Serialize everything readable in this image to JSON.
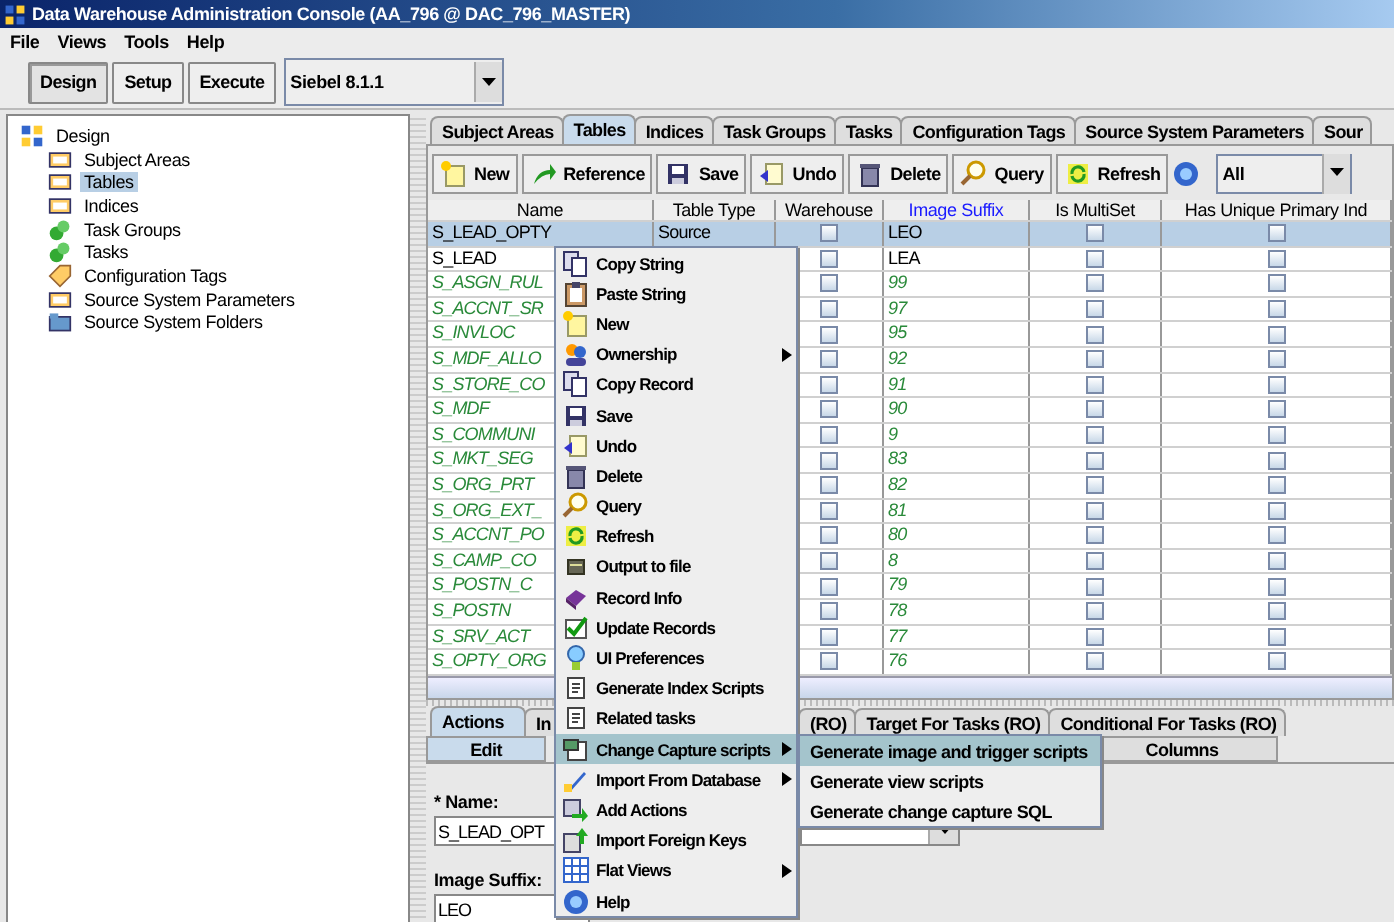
{
  "window": {
    "title": "Data Warehouse Administration Console (AA_796 @ DAC_796_MASTER)"
  },
  "menu_bar": [
    "File",
    "Views",
    "Tools",
    "Help"
  ],
  "toolbar": {
    "buttons": [
      {
        "label": "Design",
        "selected": true
      },
      {
        "label": "Setup",
        "selected": false
      },
      {
        "label": "Execute",
        "selected": false
      }
    ],
    "container": {
      "value": "Siebel 8.1.1"
    }
  },
  "tree": {
    "label": "Design",
    "children": [
      {
        "label": "Subject Areas",
        "selected": false
      },
      {
        "label": "Tables",
        "selected": true
      },
      {
        "label": "Indices",
        "selected": false
      },
      {
        "label": "Task Groups",
        "selected": false
      },
      {
        "label": "Tasks",
        "selected": false
      },
      {
        "label": "Configuration Tags",
        "selected": false
      },
      {
        "label": "Source System Parameters",
        "selected": false
      },
      {
        "label": "Source System Folders",
        "selected": false
      }
    ]
  },
  "tabs": [
    {
      "label": "Subject Areas",
      "selected": false
    },
    {
      "label": "Tables",
      "selected": true
    },
    {
      "label": "Indices",
      "selected": false
    },
    {
      "label": "Task Groups",
      "selected": false
    },
    {
      "label": "Tasks",
      "selected": false
    },
    {
      "label": "Configuration Tags",
      "selected": false
    },
    {
      "label": "Source System Parameters",
      "selected": false
    },
    {
      "label": "Sour",
      "selected": false
    }
  ],
  "table_toolbar": {
    "buttons": [
      "New",
      "Reference",
      "Save",
      "Undo",
      "Delete",
      "Query",
      "Refresh"
    ],
    "filter": {
      "value": "All"
    }
  },
  "table": {
    "columns": [
      {
        "label": "Name",
        "highlighted": false
      },
      {
        "label": "Table Type",
        "highlighted": false
      },
      {
        "label": "Warehouse",
        "highlighted": false
      },
      {
        "label": "Image Suffix",
        "highlighted": true
      },
      {
        "label": "Is MultiSet",
        "highlighted": false
      },
      {
        "label": "Has Unique Primary Ind",
        "highlighted": false
      }
    ],
    "rows": [
      {
        "name": "S_LEAD_OPTY",
        "table_type": "Source",
        "warehouse": false,
        "image_suffix": "LEO",
        "is_multiset": false,
        "has_unique_primary_index": false,
        "kind": "own",
        "selected": true
      },
      {
        "name": "S_LEAD",
        "warehouse": false,
        "image_suffix": "LEA",
        "is_multiset": false,
        "has_unique_primary_index": false,
        "kind": "own",
        "selected": false
      },
      {
        "name": "S_ASGN_RUL",
        "warehouse": false,
        "image_suffix": "99",
        "is_multiset": false,
        "has_unique_primary_index": false,
        "kind": "inherited",
        "selected": false
      },
      {
        "name": "S_ACCNT_SR",
        "warehouse": false,
        "image_suffix": "97",
        "is_multiset": false,
        "has_unique_primary_index": false,
        "kind": "inherited",
        "selected": false
      },
      {
        "name": "S_INVLOC",
        "warehouse": false,
        "image_suffix": "95",
        "is_multiset": false,
        "has_unique_primary_index": false,
        "kind": "inherited",
        "selected": false
      },
      {
        "name": "S_MDF_ALLO",
        "warehouse": false,
        "image_suffix": "92",
        "is_multiset": false,
        "has_unique_primary_index": false,
        "kind": "inherited",
        "selected": false
      },
      {
        "name": "S_STORE_CO",
        "warehouse": false,
        "image_suffix": "91",
        "is_multiset": false,
        "has_unique_primary_index": false,
        "kind": "inherited",
        "selected": false
      },
      {
        "name": "S_MDF",
        "warehouse": false,
        "image_suffix": "90",
        "is_multiset": false,
        "has_unique_primary_index": false,
        "kind": "inherited",
        "selected": false
      },
      {
        "name": "S_COMMUNI",
        "warehouse": false,
        "image_suffix": "9",
        "is_multiset": false,
        "has_unique_primary_index": false,
        "kind": "inherited",
        "selected": false
      },
      {
        "name": "S_MKT_SEG",
        "warehouse": false,
        "image_suffix": "83",
        "is_multiset": false,
        "has_unique_primary_index": false,
        "kind": "inherited",
        "selected": false
      },
      {
        "name": "S_ORG_PRT",
        "warehouse": false,
        "image_suffix": "82",
        "is_multiset": false,
        "has_unique_primary_index": false,
        "kind": "inherited",
        "selected": false
      },
      {
        "name": "S_ORG_EXT_",
        "warehouse": false,
        "image_suffix": "81",
        "is_multiset": false,
        "has_unique_primary_index": false,
        "kind": "inherited",
        "selected": false
      },
      {
        "name": "S_ACCNT_PO",
        "warehouse": false,
        "image_suffix": "80",
        "is_multiset": false,
        "has_unique_primary_index": false,
        "kind": "inherited",
        "selected": false
      },
      {
        "name": "S_CAMP_CO",
        "warehouse": false,
        "image_suffix": "8",
        "is_multiset": false,
        "has_unique_primary_index": false,
        "kind": "inherited",
        "selected": false
      },
      {
        "name": "S_POSTN_C",
        "warehouse": false,
        "image_suffix": "79",
        "is_multiset": false,
        "has_unique_primary_index": false,
        "kind": "inherited",
        "selected": false
      },
      {
        "name": "S_POSTN",
        "warehouse": false,
        "image_suffix": "78",
        "is_multiset": false,
        "has_unique_primary_index": false,
        "kind": "inherited",
        "selected": false
      },
      {
        "name": "S_SRV_ACT",
        "warehouse": false,
        "image_suffix": "77",
        "is_multiset": false,
        "has_unique_primary_index": false,
        "kind": "inherited",
        "selected": false
      },
      {
        "name": "S_OPTY_ORG",
        "warehouse": false,
        "image_suffix": "76",
        "is_multiset": false,
        "has_unique_primary_index": false,
        "kind": "inherited",
        "selected": false
      }
    ]
  },
  "detail_tabs": [
    {
      "label": "Actions",
      "selected": true
    },
    {
      "label": "In",
      "selected": false
    },
    {
      "label": "(RO)",
      "selected": false
    },
    {
      "label": "Target For Tasks (RO)",
      "selected": false
    },
    {
      "label": "Conditional For Tasks (RO)",
      "selected": false
    }
  ],
  "detail_subtabs": [
    {
      "label": "Edit",
      "selected": true
    },
    {
      "label": "Columns",
      "selected": false
    }
  ],
  "form": {
    "name_label": "* Name:",
    "name_value": "S_LEAD_OPT",
    "image_suffix_label": "Image Suffix:",
    "image_suffix_value": "LEO"
  },
  "context_menu": {
    "items": [
      {
        "label": "Copy String",
        "has_submenu": false,
        "selected": false
      },
      {
        "label": "Paste String",
        "has_submenu": false,
        "selected": false
      },
      {
        "label": "New",
        "has_submenu": false,
        "selected": false
      },
      {
        "label": "Ownership",
        "has_submenu": true,
        "selected": false
      },
      {
        "label": "Copy Record",
        "has_submenu": false,
        "selected": false
      },
      {
        "label": "Save",
        "has_submenu": false,
        "selected": false
      },
      {
        "label": "Undo",
        "has_submenu": false,
        "selected": false
      },
      {
        "label": "Delete",
        "has_submenu": false,
        "selected": false
      },
      {
        "label": "Query",
        "has_submenu": false,
        "selected": false
      },
      {
        "label": "Refresh",
        "has_submenu": false,
        "selected": false
      },
      {
        "label": "Output to file",
        "has_submenu": false,
        "selected": false
      },
      {
        "label": "Record Info",
        "has_submenu": false,
        "selected": false
      },
      {
        "label": "Update Records",
        "has_submenu": false,
        "selected": false
      },
      {
        "label": "UI Preferences",
        "has_submenu": false,
        "selected": false
      },
      {
        "label": "Generate Index Scripts",
        "has_submenu": false,
        "selected": false
      },
      {
        "label": "Related tasks",
        "has_submenu": false,
        "selected": false
      },
      {
        "label": "Change Capture scripts",
        "has_submenu": true,
        "selected": true
      },
      {
        "label": "Import From Database",
        "has_submenu": true,
        "selected": false
      },
      {
        "label": "Add Actions",
        "has_submenu": false,
        "selected": false
      },
      {
        "label": "Import Foreign Keys",
        "has_submenu": false,
        "selected": false
      },
      {
        "label": "Flat Views",
        "has_submenu": true,
        "selected": false
      },
      {
        "label": "Help",
        "has_submenu": false,
        "selected": false
      }
    ],
    "submenu": {
      "items": [
        {
          "label": "Generate image and trigger scripts",
          "selected": true
        },
        {
          "label": "Generate view scripts",
          "selected": false
        },
        {
          "label": "Generate change capture SQL",
          "selected": false
        }
      ]
    }
  }
}
